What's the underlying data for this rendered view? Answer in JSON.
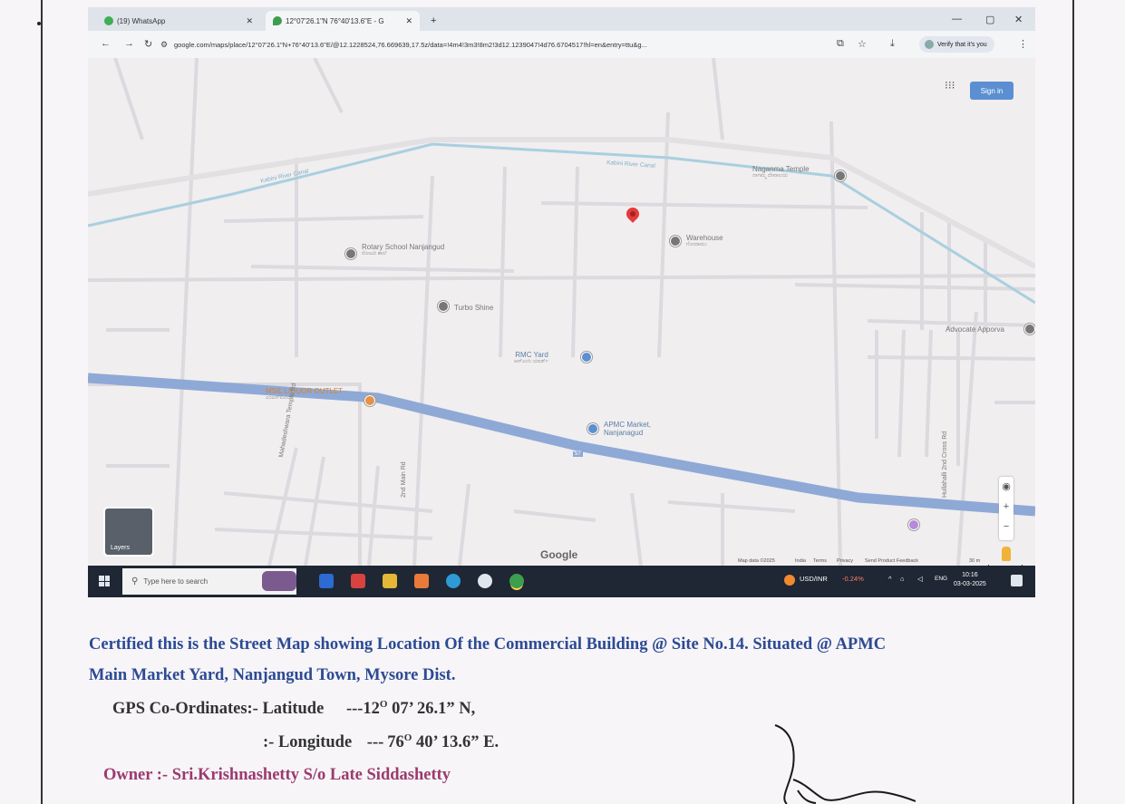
{
  "browser": {
    "tabs": [
      {
        "label": "(19) WhatsApp"
      },
      {
        "label": "12°07'26.1\"N 76°40'13.6\"E - G"
      }
    ],
    "new_tab": "+",
    "url": "google.com/maps/place/12°07'26.1\"N+76°40'13.6\"E/@12.1228524,76.669639,17.5z/data=!4m4!3m3!8m2!3d12.1239047!4d76.6704517!hl=en&entry=ttu&g...",
    "verify_label": "Verify that it's you"
  },
  "map": {
    "sign_in": "Sign in",
    "layers_label": "Layers",
    "logo": "Google",
    "labels": {
      "canal_left": "Kabini River Canal",
      "canal_right": "Kabini River Canal",
      "naganma": "Naganma Temple",
      "naganma_sub": "ನಾಗಮ್ಮ ದೇವಾಲಯ",
      "warehouse": "Warehouse",
      "warehouse_sub": "ಗೋದಾಮು",
      "rotary": "Rotary School Nanjangud",
      "rotary_sub": "ರೋಟರಿ ಶಾಲೆ",
      "turbo": "Turbo Shine",
      "rmc": "RMC Yard",
      "rmc_sub": "ಆರ್‌ಎಂಸಿ ಯಾರ್ಡ್",
      "liquor": "MSIL LIQUOR OUTLET",
      "liquor_sub": "ಎಂಎಸ್ಐಎಲ್",
      "apmc_line1": "APMC Market,",
      "apmc_line2": "Nanjanagud",
      "advocate": "Advocate Apporva",
      "mahadeshwara": "Mahadeshwara Temple Rd",
      "main_rd": "2nd Main Rd",
      "hullahalli": "Hullahalli 2nd Cross Rd",
      "route": "57"
    },
    "footer": {
      "map_data": "Map data ©2025",
      "india": "India",
      "terms": "Terms",
      "privacy": "Privacy",
      "feedback": "Send Product Feedback",
      "scale": "30 m"
    }
  },
  "taskbar": {
    "search_placeholder": "Type here to search",
    "ticker": "USD/INR",
    "ticker_change": "-0.24%",
    "lang": "ENG",
    "time": "10:16",
    "date": "03-03-2025"
  },
  "certificate": {
    "line1": "Certified this is the Street Map showing Location Of  the Commercial  Building  @ Site  No.14.  Situated @ APMC",
    "line2": "Main Market Yard, Nanjangud  Town, Mysore Dist.",
    "gps_label": "GPS Co-Ordinates:-  Latitude",
    "lat_dash": "---",
    "lat_deg": "12",
    "lat_rest": " 07’ 26.1” N,",
    "lon_label": ":-  Longitude",
    "lon_dash": "---",
    "lon_deg": "76",
    "lon_rest": " 40’ 13.6” E.",
    "degree_mark": "O",
    "owner": "Owner :- Sri.Krishnashetty S/o Late  Siddashetty"
  },
  "colors": {
    "certificate_text": "#2c4a93",
    "owner_text": "#9b3a6e",
    "pin": "#e43b3b",
    "highway": "#8fa9d6",
    "canal": "#a9cfe0"
  }
}
